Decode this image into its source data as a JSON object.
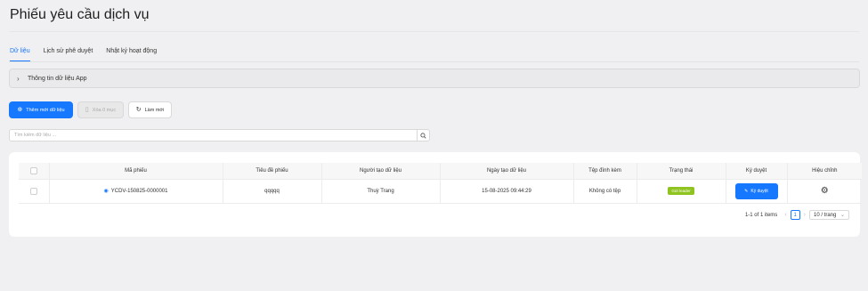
{
  "page": {
    "title": "Phiếu yêu cầu dịch vụ"
  },
  "tabs": [
    {
      "label": "Dữ liệu",
      "active": true
    },
    {
      "label": "Lịch sử phê duyệt",
      "active": false
    },
    {
      "label": "Nhật ký hoạt động",
      "active": false
    }
  ],
  "collapse": {
    "label": "Thông tin dữ liệu App",
    "icon": "chevron-right-icon"
  },
  "toolbar": {
    "add_label": "Thêm mới dữ liệu",
    "delete_label": "Xóa 0 mục",
    "refresh_label": "Làm mới"
  },
  "search": {
    "placeholder": "Tìm kiếm dữ liệu ...",
    "value": ""
  },
  "table": {
    "columns": [
      "Mã phiếu",
      "Tiêu đề phiếu",
      "Người tạo dữ liệu",
      "Ngày tạo dữ liệu",
      "Tệp đính kèm",
      "Trạng thái",
      "Ký duyệt",
      "Hiệu chỉnh"
    ],
    "rows": [
      {
        "code": "YCDV-150825-0000001",
        "title": "qqqqq",
        "creator": "Thuỳ Trang",
        "created_at": "15-08-2025 09:44:29",
        "attachment": "Không có tệp",
        "status": "Gửi leader",
        "sign_label": "Ký duyệt"
      }
    ]
  },
  "pagination": {
    "summary": "1-1 of 1 items",
    "current_page": "1",
    "page_size": "10 / trang"
  },
  "colors": {
    "primary": "#1677ff",
    "status_badge": "#8fc31f"
  }
}
